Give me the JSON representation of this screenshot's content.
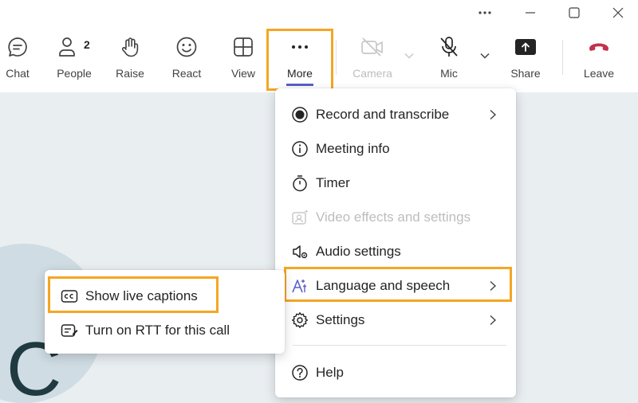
{
  "toolbar": {
    "chat": "Chat",
    "people": "People",
    "people_count": "2",
    "raise": "Raise",
    "react": "React",
    "view": "View",
    "more": "More",
    "camera": "Camera",
    "mic": "Mic",
    "share": "Share",
    "leave": "Leave"
  },
  "more_menu": {
    "items": [
      {
        "label": "Record and transcribe",
        "icon": "record-icon",
        "has_submenu": true
      },
      {
        "label": "Meeting info",
        "icon": "info-icon",
        "has_submenu": false
      },
      {
        "label": "Timer",
        "icon": "timer-icon",
        "has_submenu": false
      },
      {
        "label": "Video effects and settings",
        "icon": "video-effects-icon",
        "has_submenu": false,
        "disabled": true
      },
      {
        "label": "Audio settings",
        "icon": "speaker-settings-icon",
        "has_submenu": false
      },
      {
        "label": "Language and speech",
        "icon": "language-icon",
        "has_submenu": true
      },
      {
        "label": "Settings",
        "icon": "gear-icon",
        "has_submenu": true
      },
      {
        "label": "Help",
        "icon": "help-icon",
        "has_submenu": false
      }
    ]
  },
  "language_submenu": {
    "items": [
      {
        "label": "Show live captions",
        "icon": "cc-icon"
      },
      {
        "label": "Turn on RTT for this call",
        "icon": "rtt-icon"
      }
    ]
  },
  "stage": {
    "avatar_letter": "C"
  },
  "colors": {
    "highlight": "#f5a623",
    "leave": "#c4314b",
    "stage_bg": "#e9eef1"
  }
}
